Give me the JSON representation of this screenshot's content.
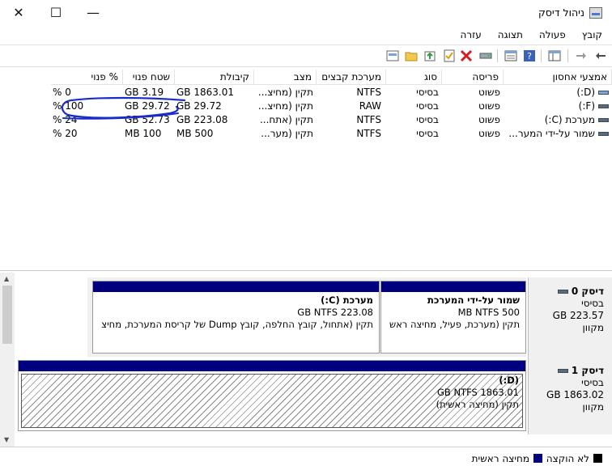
{
  "window": {
    "title": "ניהול דיסק",
    "minimize_glyph": "—",
    "maximize_glyph": "☐",
    "close_glyph": "✕"
  },
  "menu": [
    "קובץ",
    "פעולה",
    "תצוגה",
    "עזרה"
  ],
  "toolbar": {
    "icons": [
      "back-icon",
      "forward-icon",
      "console-tree-icon",
      "properties-icon",
      "help-icon",
      "disk-list-icon",
      "connect-drive-icon",
      "delete-icon",
      "check-icon",
      "explore-icon",
      "folder-icon",
      "disk-view-icon"
    ]
  },
  "volumes": {
    "columns": [
      "אמצעי אחסון",
      "פריסה",
      "סוג",
      "מערכת קבצים",
      "מצב",
      "קיבולת",
      "שטח פנוי",
      "% פנוי"
    ],
    "rows": [
      {
        "volume": "(D:)",
        "layout": "פשוט",
        "type": "בסיסי",
        "fs": "NTFS",
        "status": "תקין (מחיצ...",
        "capacity": "1863.01 GB",
        "free": "3.19 GB",
        "pct": "0 %"
      },
      {
        "volume": "(F:)",
        "layout": "פשוט",
        "type": "בסיסי",
        "fs": "RAW",
        "status": "תקין (מחיצ...",
        "capacity": "29.72 GB",
        "free": "29.72 GB",
        "pct": "100 %"
      },
      {
        "volume": "מערכת (C:)",
        "layout": "פשוט",
        "type": "בסיסי",
        "fs": "NTFS",
        "status": "תקין (אתח...",
        "capacity": "223.08 GB",
        "free": "52.73 GB",
        "pct": "24 %"
      },
      {
        "volume": "שמור על-ידי המער...",
        "layout": "פשוט",
        "type": "בסיסי",
        "fs": "NTFS",
        "status": "תקין (מער...",
        "capacity": "500 MB",
        "free": "100 MB",
        "pct": "20 %"
      }
    ]
  },
  "disks": [
    {
      "name": "דיסק 0",
      "type": "בסיסי",
      "size": "223.57 GB",
      "state": "מקוון",
      "partitions": [
        {
          "name": "שמור על-ידי המערכת",
          "size": "500 MB NTFS",
          "status": "תקין (מערכת, פעיל, מחיצה ראש"
        },
        {
          "name": "מערכת  (C:)",
          "size": "223.08 GB NTFS",
          "status": "תקין (אתחול, קובץ החלפה, קובץ Dump של קריסת המערכת, מחיצ"
        }
      ]
    },
    {
      "name": "דיסק 1",
      "type": "בסיסי",
      "size": "1863.02 GB",
      "state": "מקוון",
      "partitions": [
        {
          "name": "(D:)",
          "size": "1863.01 GB NTFS",
          "status": "תקין (מחיצה ראשית)"
        }
      ]
    }
  ],
  "legend": [
    {
      "label": "לא הוקצה",
      "color": "#000000"
    },
    {
      "label": "מחיצה ראשית",
      "color": "#00007f"
    }
  ],
  "colors": {
    "partition_bar": "#00007f",
    "annotation": "#1a2ec7"
  }
}
